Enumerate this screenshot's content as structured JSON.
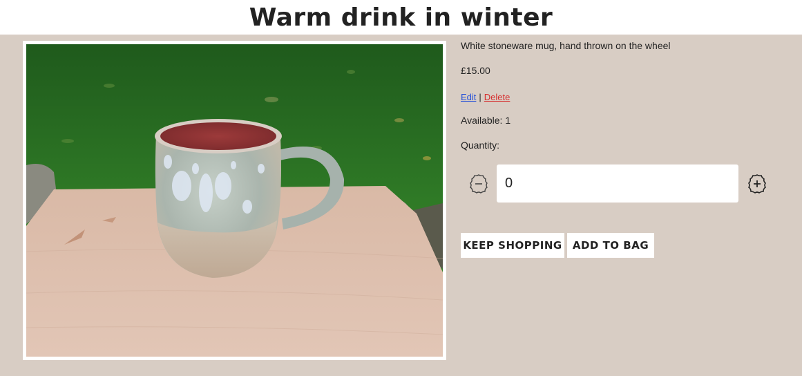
{
  "product": {
    "title": "Warm drink in winter",
    "description": "White stoneware mug, hand thrown on the wheel",
    "price": "£15.00",
    "available": "Available: 1",
    "image_alt": "Mug photo"
  },
  "admin": {
    "edit_label": "Edit",
    "separator": "|",
    "delete_label": "Delete"
  },
  "quantity": {
    "label": "Quantity:",
    "value": "0"
  },
  "actions": {
    "keep_shopping_label": "KEEP SHOPPING",
    "add_to_bag_label": "ADD TO BAG"
  },
  "icons": {
    "minus": "minus-circle-icon",
    "plus": "plus-circle-icon"
  },
  "colors": {
    "background": "#d8cdc4",
    "edit_link": "#2450d8",
    "delete_link": "#d63030"
  }
}
